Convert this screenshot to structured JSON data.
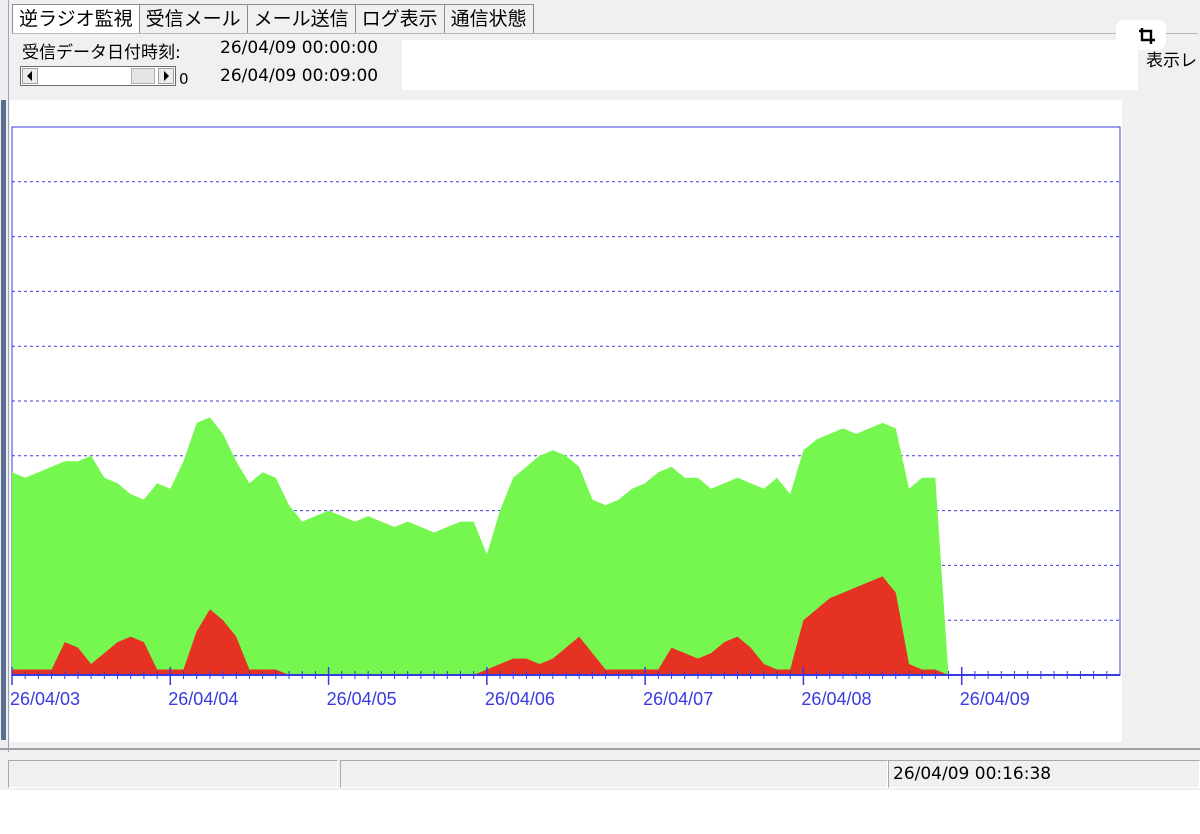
{
  "tabs": [
    "逆ラジオ監視",
    "受信メール",
    "メール送信",
    "ログ表示",
    "通信状態"
  ],
  "active_tab": 0,
  "receive_datetime_label": "受信データ日付時刻:",
  "receive_datetime_value": "26/04/09 00:00:00",
  "scroll_value": "0",
  "current_datetime_value": "26/04/09 00:09:00",
  "right_label": "表示レ",
  "status": {
    "cell1": "",
    "cell2": "",
    "timestamp": "26/04/09 00:16:38"
  },
  "colors": {
    "green_area": "#76f74f",
    "red_area": "#e53222",
    "axis": "#3a3ae0",
    "grid": "#3a3ae0"
  },
  "chart_data": {
    "type": "area",
    "stacked": false,
    "x_unit": "day",
    "xlim": [
      "26/04/03 00:00",
      "26/04/10 00:00"
    ],
    "x_tick_labels": [
      "26/04/03",
      "26/04/04",
      "26/04/05",
      "26/04/06",
      "26/04/07",
      "26/04/08",
      "26/04/09"
    ],
    "ylim": [
      0,
      10
    ],
    "y_gridlines": [
      1,
      2,
      3,
      4,
      5,
      6,
      7,
      8,
      9
    ],
    "grid": true,
    "series": [
      {
        "color": "green",
        "x": [
          "26/04/03 00:00",
          "26/04/03 02:00",
          "26/04/03 04:00",
          "26/04/03 06:00",
          "26/04/03 08:00",
          "26/04/03 10:00",
          "26/04/03 12:00",
          "26/04/03 14:00",
          "26/04/03 16:00",
          "26/04/03 18:00",
          "26/04/03 20:00",
          "26/04/03 22:00",
          "26/04/04 00:00",
          "26/04/04 02:00",
          "26/04/04 04:00",
          "26/04/04 06:00",
          "26/04/04 08:00",
          "26/04/04 10:00",
          "26/04/04 12:00",
          "26/04/04 14:00",
          "26/04/04 16:00",
          "26/04/04 18:00",
          "26/04/04 20:00",
          "26/04/04 22:00",
          "26/04/05 00:00",
          "26/04/05 02:00",
          "26/04/05 04:00",
          "26/04/05 06:00",
          "26/04/05 08:00",
          "26/04/05 10:00",
          "26/04/05 12:00",
          "26/04/05 14:00",
          "26/04/05 16:00",
          "26/04/05 18:00",
          "26/04/05 20:00",
          "26/04/05 22:00",
          "26/04/06 00:00",
          "26/04/06 02:00",
          "26/04/06 04:00",
          "26/04/06 06:00",
          "26/04/06 08:00",
          "26/04/06 10:00",
          "26/04/06 12:00",
          "26/04/06 14:00",
          "26/04/06 16:00",
          "26/04/06 18:00",
          "26/04/06 20:00",
          "26/04/06 22:00",
          "26/04/07 00:00",
          "26/04/07 02:00",
          "26/04/07 04:00",
          "26/04/07 06:00",
          "26/04/07 08:00",
          "26/04/07 10:00",
          "26/04/07 12:00",
          "26/04/07 14:00",
          "26/04/07 16:00",
          "26/04/07 18:00",
          "26/04/07 20:00",
          "26/04/07 22:00",
          "26/04/08 00:00",
          "26/04/08 02:00",
          "26/04/08 04:00",
          "26/04/08 06:00",
          "26/04/08 08:00",
          "26/04/08 10:00",
          "26/04/08 12:00",
          "26/04/08 14:00",
          "26/04/08 16:00",
          "26/04/08 18:00",
          "26/04/08 20:00",
          "26/04/08 22:00",
          "26/04/09 00:00",
          "26/04/09 00:09"
        ],
        "values": [
          3.7,
          3.6,
          3.7,
          3.8,
          3.9,
          3.9,
          4.0,
          3.6,
          3.5,
          3.3,
          3.2,
          3.5,
          3.4,
          3.9,
          4.6,
          4.7,
          4.4,
          3.9,
          3.5,
          3.7,
          3.6,
          3.1,
          2.8,
          2.9,
          3.0,
          2.9,
          2.8,
          2.9,
          2.8,
          2.7,
          2.8,
          2.7,
          2.6,
          2.7,
          2.8,
          2.8,
          2.2,
          3.0,
          3.6,
          3.8,
          4.0,
          4.1,
          4.0,
          3.8,
          3.2,
          3.1,
          3.2,
          3.4,
          3.5,
          3.7,
          3.8,
          3.6,
          3.6,
          3.4,
          3.5,
          3.6,
          3.5,
          3.4,
          3.6,
          3.3,
          4.1,
          4.3,
          4.4,
          4.5,
          4.4,
          4.5,
          4.6,
          4.5,
          3.4,
          3.6,
          3.6,
          0.0,
          0.0,
          0.0
        ]
      },
      {
        "color": "red",
        "x": [
          "26/04/03 00:00",
          "26/04/03 02:00",
          "26/04/03 04:00",
          "26/04/03 06:00",
          "26/04/03 08:00",
          "26/04/03 10:00",
          "26/04/03 12:00",
          "26/04/03 14:00",
          "26/04/03 16:00",
          "26/04/03 18:00",
          "26/04/03 20:00",
          "26/04/03 22:00",
          "26/04/04 00:00",
          "26/04/04 02:00",
          "26/04/04 04:00",
          "26/04/04 06:00",
          "26/04/04 08:00",
          "26/04/04 10:00",
          "26/04/04 12:00",
          "26/04/04 14:00",
          "26/04/04 16:00",
          "26/04/04 18:00",
          "26/04/04 20:00",
          "26/04/04 22:00",
          "26/04/05 00:00",
          "26/04/05 02:00",
          "26/04/05 04:00",
          "26/04/05 06:00",
          "26/04/05 08:00",
          "26/04/05 10:00",
          "26/04/05 12:00",
          "26/04/05 14:00",
          "26/04/05 16:00",
          "26/04/05 18:00",
          "26/04/05 20:00",
          "26/04/05 22:00",
          "26/04/06 00:00",
          "26/04/06 02:00",
          "26/04/06 04:00",
          "26/04/06 06:00",
          "26/04/06 08:00",
          "26/04/06 10:00",
          "26/04/06 12:00",
          "26/04/06 14:00",
          "26/04/06 16:00",
          "26/04/06 18:00",
          "26/04/06 20:00",
          "26/04/06 22:00",
          "26/04/07 00:00",
          "26/04/07 02:00",
          "26/04/07 04:00",
          "26/04/07 06:00",
          "26/04/07 08:00",
          "26/04/07 10:00",
          "26/04/07 12:00",
          "26/04/07 14:00",
          "26/04/07 16:00",
          "26/04/07 18:00",
          "26/04/07 20:00",
          "26/04/07 22:00",
          "26/04/08 00:00",
          "26/04/08 02:00",
          "26/04/08 04:00",
          "26/04/08 06:00",
          "26/04/08 08:00",
          "26/04/08 10:00",
          "26/04/08 12:00",
          "26/04/08 14:00",
          "26/04/08 16:00",
          "26/04/08 18:00",
          "26/04/08 20:00",
          "26/04/08 22:00",
          "26/04/09 00:00",
          "26/04/09 00:09"
        ],
        "values": [
          0.1,
          0.1,
          0.1,
          0.1,
          0.6,
          0.5,
          0.2,
          0.4,
          0.6,
          0.7,
          0.6,
          0.1,
          0.1,
          0.1,
          0.8,
          1.2,
          1.0,
          0.7,
          0.1,
          0.1,
          0.1,
          0.0,
          0.0,
          0.0,
          0.0,
          0.0,
          0.0,
          0.0,
          0.0,
          0.0,
          0.0,
          0.0,
          0.0,
          0.0,
          0.0,
          0.0,
          0.1,
          0.2,
          0.3,
          0.3,
          0.2,
          0.3,
          0.5,
          0.7,
          0.4,
          0.1,
          0.1,
          0.1,
          0.1,
          0.1,
          0.5,
          0.4,
          0.3,
          0.4,
          0.6,
          0.7,
          0.5,
          0.2,
          0.1,
          0.1,
          1.0,
          1.2,
          1.4,
          1.5,
          1.6,
          1.7,
          1.8,
          1.5,
          0.2,
          0.1,
          0.1,
          0.0,
          0.0,
          0.0
        ]
      }
    ]
  }
}
